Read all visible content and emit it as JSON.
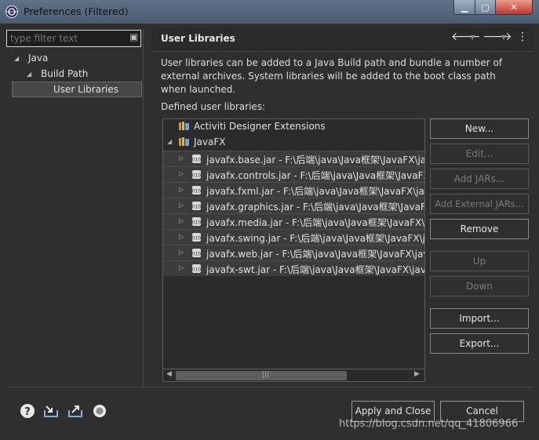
{
  "window": {
    "title": "Preferences (Filtered)"
  },
  "filter": {
    "placeholder": "type filter text"
  },
  "tree": [
    {
      "label": "Java"
    },
    {
      "label": "Build Path"
    },
    {
      "label": "User Libraries"
    }
  ],
  "page": {
    "title": "User Libraries",
    "description": "User libraries can be added to a Java Build path and bundle a number of external archives. System libraries will be added to the boot class path when launched.",
    "defined_label": "Defined user libraries:"
  },
  "libraries": [
    {
      "label": "Activiti Designer Extensions"
    },
    {
      "label": "JavaFX"
    }
  ],
  "jars": [
    {
      "label": "javafx.base.jar - F:\\后端\\java\\Java框架\\JavaFX\\java"
    },
    {
      "label": "javafx.controls.jar - F:\\后端\\java\\Java框架\\JavaFX\\"
    },
    {
      "label": "javafx.fxml.jar - F:\\后端\\java\\Java框架\\JavaFX\\java"
    },
    {
      "label": "javafx.graphics.jar - F:\\后端\\java\\Java框架\\JavaFX\\j"
    },
    {
      "label": "javafx.media.jar - F:\\后端\\java\\Java框架\\JavaFX\\java"
    },
    {
      "label": "javafx.swing.jar - F:\\后端\\java\\Java框架\\JavaFX\\ja"
    },
    {
      "label": "javafx.web.jar - F:\\后端\\java\\Java框架\\JavaFX\\java"
    },
    {
      "label": "javafx-swt.jar - F:\\后端\\java\\Java框架\\JavaFX\\java"
    }
  ],
  "buttons": {
    "new": "New...",
    "edit": "Edit...",
    "add_jars": "Add JARs...",
    "add_external_jars": "Add External JARs...",
    "remove": "Remove",
    "up": "Up",
    "down": "Down",
    "import": "Import...",
    "export": "Export..."
  },
  "footer": {
    "apply_close": "Apply and Close",
    "cancel": "Cancel"
  },
  "watermark": "https://blog.csdn.net/qq_41806966",
  "icons": {
    "window": "eclipse-icon",
    "help": "help-icon",
    "import_prefs": "import-icon",
    "export_prefs": "export-icon",
    "record": "record-icon"
  }
}
